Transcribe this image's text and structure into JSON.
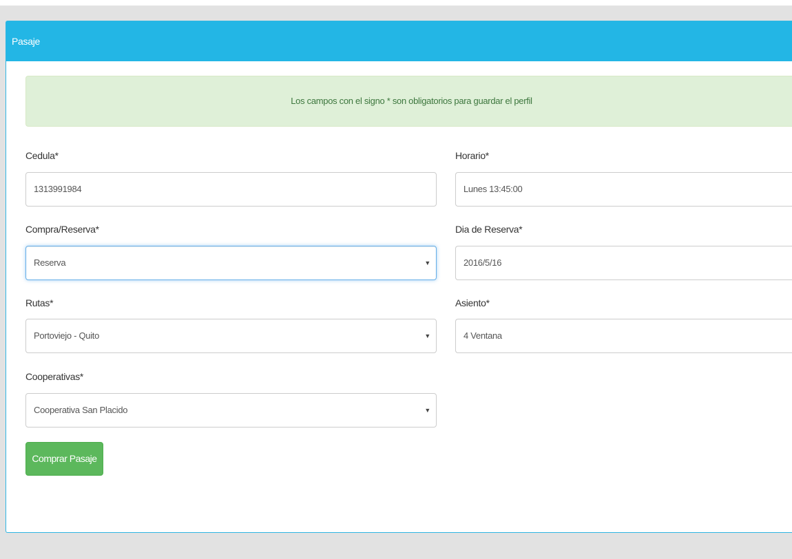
{
  "panel": {
    "title": "Pasaje"
  },
  "alert": {
    "message": "Los campos con el signo * son obligatorios para guardar el perfil"
  },
  "form": {
    "cedula": {
      "label": "Cedula*",
      "value": "1313991984"
    },
    "compra_reserva": {
      "label": "Compra/Reserva*",
      "value": "Reserva"
    },
    "rutas": {
      "label": "Rutas*",
      "value": "Portoviejo - Quito"
    },
    "cooperativas": {
      "label": "Cooperativas*",
      "value": "Cooperativa San Placido"
    },
    "horario": {
      "label": "Horario*",
      "value": "Lunes 13:45:00"
    },
    "dia_reserva": {
      "label": "Dia de Reserva*",
      "value": "2016/5/16"
    },
    "asiento": {
      "label": "Asiento*",
      "value": "4 Ventana"
    },
    "submit_label": "Comprar Pasaje"
  },
  "icons": {
    "select_caret": "chevron-down-icon",
    "select_caret_glyph": "▼"
  },
  "colors": {
    "heading_bg": "#23b6e5",
    "alert_bg": "#dff0d8",
    "alert_text": "#3c763d",
    "button_bg": "#5cb85c",
    "focus_border": "#66afe9"
  }
}
